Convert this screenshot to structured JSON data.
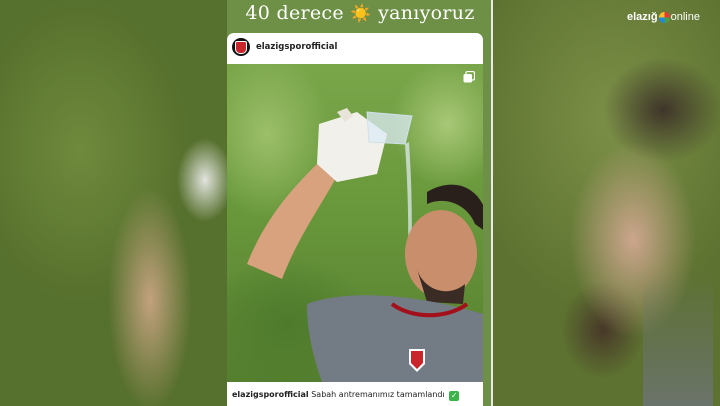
{
  "headline": {
    "text_before": "40 derece",
    "sun_icon": "☀️",
    "text_after": "yanıyoruz"
  },
  "post": {
    "username": "elazigsporofficial",
    "caption_user": "elazigsporofficial",
    "caption_text": "Sabah antremanımız tamamlandı",
    "caption_emoji": "✅",
    "multi_image_icon": "carousel-icon"
  },
  "watermark": {
    "part1": "elazığ",
    "part2": "online"
  },
  "colors": {
    "strip_green": "#6e9046",
    "check_green": "#3bb44a",
    "club_red": "#c9262c"
  }
}
